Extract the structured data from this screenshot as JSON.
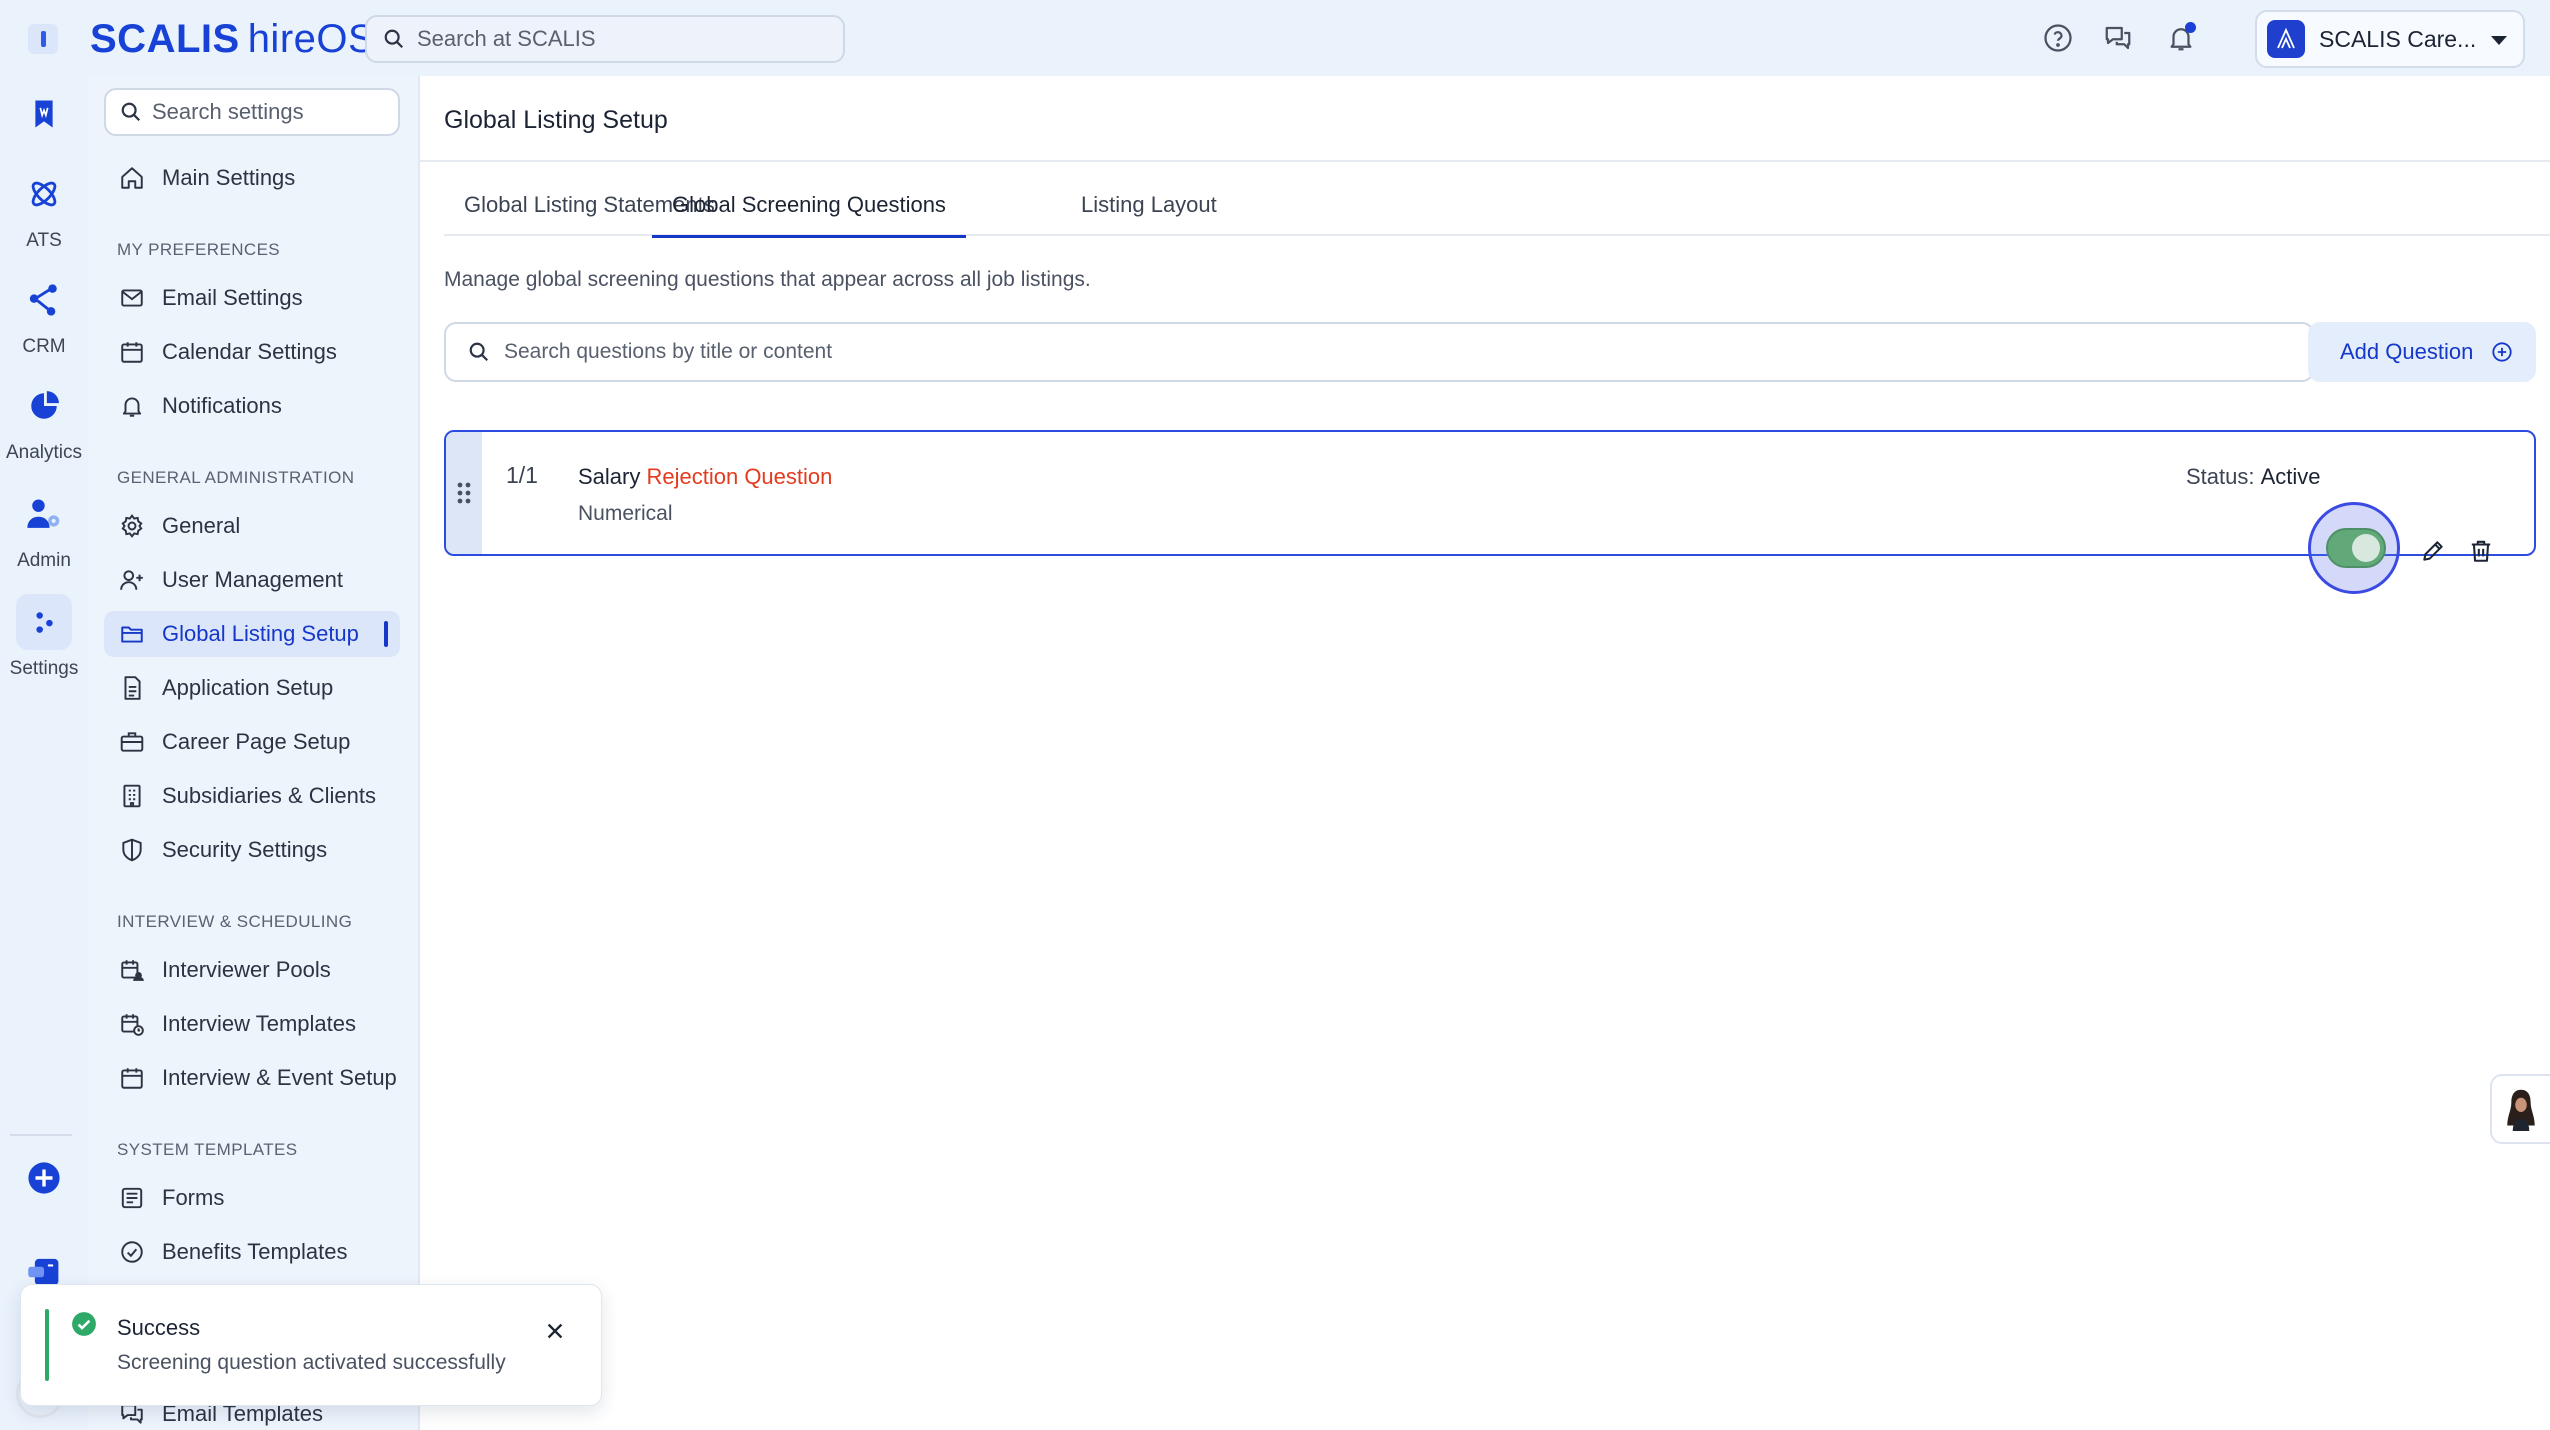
{
  "topbar": {
    "brand": "SCALIS",
    "product": "hireOS",
    "search_placeholder": "Search at SCALIS",
    "account_name": "SCALIS Care..."
  },
  "rail": {
    "items": [
      {
        "label": "",
        "icon": "bookmark-icon"
      },
      {
        "label": "ATS",
        "icon": "atom-icon"
      },
      {
        "label": "CRM",
        "icon": "nodes-icon"
      },
      {
        "label": "Analytics",
        "icon": "pie-chart-icon"
      },
      {
        "label": "Admin",
        "icon": "user-gear-icon"
      },
      {
        "label": "Settings",
        "icon": "settings-dots-icon"
      }
    ]
  },
  "sidebar": {
    "search_placeholder": "Search settings",
    "main_settings": "Main Settings",
    "sections": {
      "my_preferences": "MY PREFERENCES",
      "general_administration": "GENERAL ADMINISTRATION",
      "interview_scheduling": "INTERVIEW & SCHEDULING",
      "system_templates": "SYSTEM TEMPLATES"
    },
    "items": {
      "email_settings": "Email Settings",
      "calendar_settings": "Calendar Settings",
      "notifications": "Notifications",
      "general": "General",
      "user_management": "User Management",
      "global_listing_setup": "Global Listing Setup",
      "application_setup": "Application Setup",
      "career_page_setup": "Career Page Setup",
      "subsidiaries_clients": "Subsidiaries & Clients",
      "security_settings": "Security Settings",
      "interviewer_pools": "Interviewer Pools",
      "interview_templates": "Interview Templates",
      "interview_event_setup": "Interview & Event Setup",
      "forms": "Forms",
      "benefits_templates": "Benefits Templates",
      "email_templates": "Email Templates"
    }
  },
  "main": {
    "title": "Global Listing Setup",
    "tabs": [
      "Global Listing Statements",
      "Global Screening Questions",
      "Listing Layout"
    ],
    "active_tab": "Global Screening Questions",
    "description": "Manage global screening questions that appear across all job listings.",
    "search_placeholder": "Search questions by title or content",
    "add_button": "Add Question",
    "questions": [
      {
        "index": "1/1",
        "title_part1": "Salary",
        "title_part2": "Rejection Question",
        "type": "Numerical",
        "status_label": "Status:",
        "status_value": "Active",
        "active": true
      }
    ]
  },
  "toast": {
    "title": "Success",
    "message": "Screening question activated successfully"
  },
  "colors": {
    "brand": "#1842d6",
    "accent": "#1638c9",
    "toggle_on": "#62a97a",
    "highlight_text": "#e33b1f",
    "success": "#2fa968"
  }
}
